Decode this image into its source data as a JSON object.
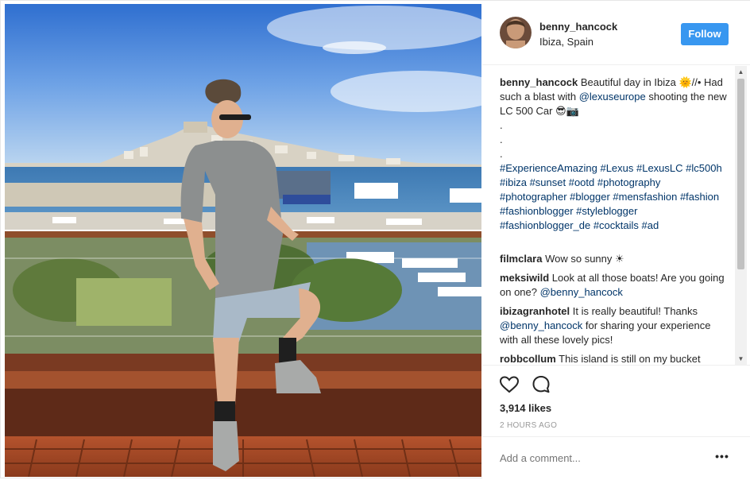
{
  "header": {
    "username": "benny_hancock",
    "location": "Ibiza, Spain",
    "follow_label": "Follow"
  },
  "caption": {
    "username": "benny_hancock",
    "text_1": " Beautiful day in Ibiza ",
    "sun_emoji": "🌞",
    "text_2": "//• Had such a blast with ",
    "mention": "@lexuseurope",
    "text_3": " shooting the new LC 500 Car ",
    "emoji_end": "😎📷",
    "dot_lines": [
      ".",
      ".",
      "."
    ],
    "hashtags": "#ExperienceAmazing #Lexus #LexusLC #lc500h #ibiza #sunset #ootd #photography #photographer #blogger #mensfashion #fashion #fashionblogger #styleblogger #fashionblogger_de #cocktails #ad"
  },
  "comments": [
    {
      "user": "filmclara",
      "text_before": " Wow so sunny ",
      "mention": "",
      "text_after": "☀"
    },
    {
      "user": "meksiwild",
      "text_before": " Look at all those boats! Are you going on one? ",
      "mention": "@benny_hancock",
      "text_after": ""
    },
    {
      "user": "ibizagranhotel",
      "text_before": " It is really beautiful! Thanks ",
      "mention": "@benny_hancock",
      "text_after": " for sharing your experience with all these lovely pics!"
    },
    {
      "user": "robbcollum",
      "text_before": " This island is still on my bucket",
      "mention": "",
      "text_after": ""
    }
  ],
  "actions": {
    "like_icon": "heart-icon",
    "comment_icon": "comment-icon",
    "likes": "3,914 likes",
    "time": "2 HOURS AGO"
  },
  "add_comment": {
    "placeholder": "Add a comment...",
    "more_label": "•••"
  },
  "colors": {
    "accent": "#3897f0",
    "link": "#003569",
    "muted": "#999999"
  }
}
